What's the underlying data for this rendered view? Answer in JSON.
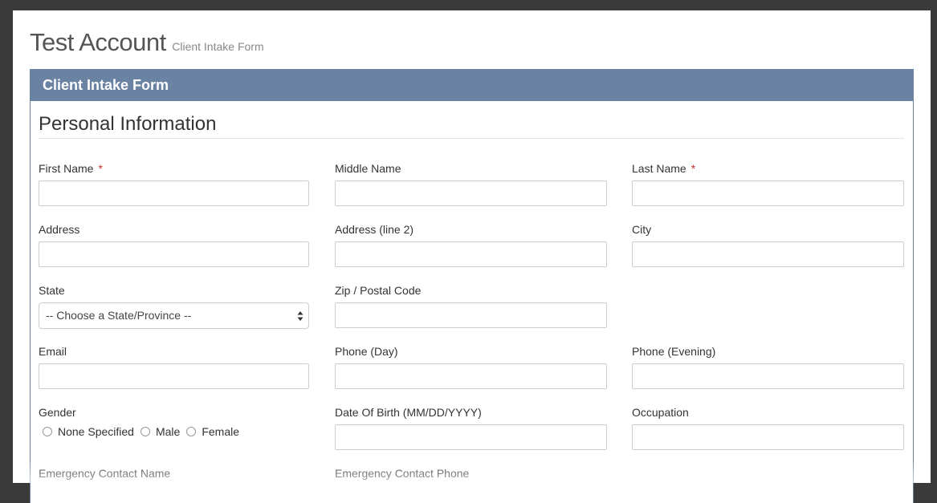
{
  "page": {
    "title": "Test Account",
    "subtitle": "Client Intake Form"
  },
  "panel": {
    "heading": "Client Intake Form",
    "section_title": "Personal Information"
  },
  "fields": {
    "first_name": {
      "label": "First Name",
      "required": "*",
      "value": ""
    },
    "middle_name": {
      "label": "Middle Name",
      "value": ""
    },
    "last_name": {
      "label": "Last Name",
      "required": "*",
      "value": ""
    },
    "address": {
      "label": "Address",
      "value": ""
    },
    "address2": {
      "label": "Address (line 2)",
      "value": ""
    },
    "city": {
      "label": "City",
      "value": ""
    },
    "state": {
      "label": "State",
      "selected": "-- Choose a State/Province --"
    },
    "zip": {
      "label": "Zip / Postal Code",
      "value": ""
    },
    "email": {
      "label": "Email",
      "value": ""
    },
    "phone_day": {
      "label": "Phone (Day)",
      "value": ""
    },
    "phone_evening": {
      "label": "Phone (Evening)",
      "value": ""
    },
    "gender": {
      "label": "Gender",
      "options": [
        "None Specified",
        "Male",
        "Female"
      ]
    },
    "dob": {
      "label": "Date Of Birth (MM/DD/YYYY)",
      "value": ""
    },
    "occupation": {
      "label": "Occupation",
      "value": ""
    },
    "emergency_name": {
      "label": "Emergency Contact Name"
    },
    "emergency_phone": {
      "label": "Emergency Contact Phone"
    }
  },
  "colors": {
    "panel_header": "#6b83a2",
    "required": "#c9302c",
    "background": "#3a3a3a"
  }
}
